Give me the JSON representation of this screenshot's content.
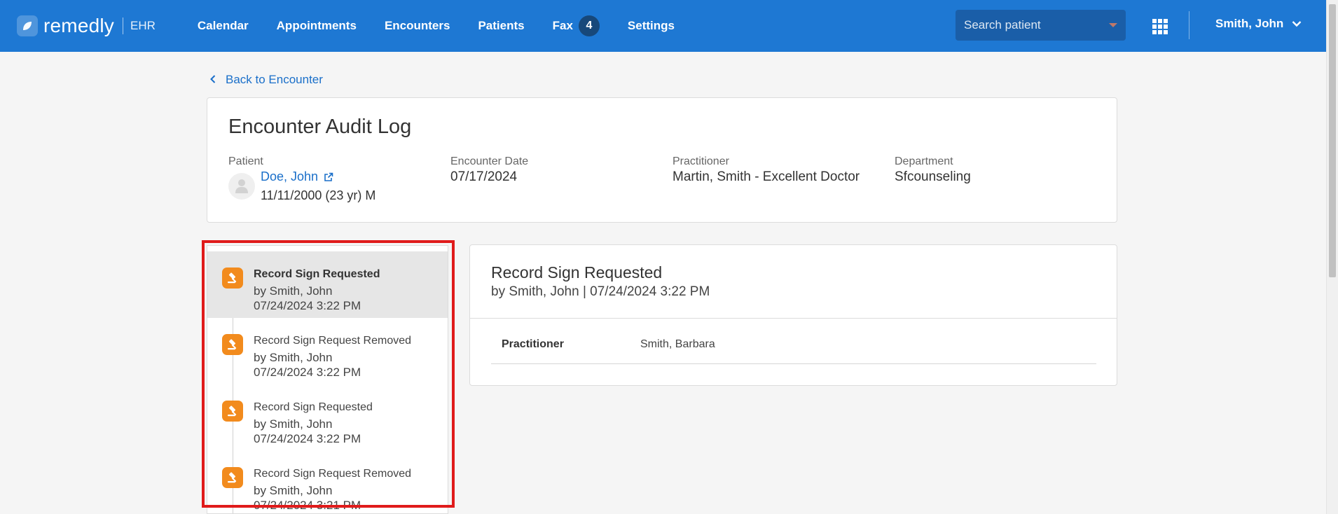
{
  "app": {
    "logo_text": "remedly",
    "logo_sub": "EHR"
  },
  "nav": {
    "items": [
      "Calendar",
      "Appointments",
      "Encounters",
      "Patients",
      "Fax",
      "Settings"
    ],
    "fax_count": "4"
  },
  "search": {
    "placeholder": "Search patient"
  },
  "user": {
    "name": "Smith, John"
  },
  "back_link": "Back to Encounter",
  "header": {
    "title": "Encounter Audit Log",
    "patient_label": "Patient",
    "patient_name": "Doe, John",
    "patient_dob": "11/11/2000 (23 yr) M",
    "date_label": "Encounter Date",
    "date_value": "07/17/2024",
    "practitioner_label": "Practitioner",
    "practitioner_value": "Martin, Smith - Excellent Doctor",
    "department_label": "Department",
    "department_value": "Sfcounseling"
  },
  "timeline": [
    {
      "title": "Record Sign Requested",
      "by": "by Smith, John",
      "date": "07/24/2024 3:22 PM"
    },
    {
      "title": "Record Sign Request Removed",
      "by": "by Smith, John",
      "date": "07/24/2024 3:22 PM"
    },
    {
      "title": "Record Sign Requested",
      "by": "by Smith, John",
      "date": "07/24/2024 3:22 PM"
    },
    {
      "title": "Record Sign Request Removed",
      "by": "by Smith, John",
      "date": "07/24/2024 3:21 PM"
    }
  ],
  "detail": {
    "title": "Record Sign Requested",
    "subtitle": "by Smith, John | 07/24/2024 3:22 PM",
    "row_label": "Practitioner",
    "row_value": "Smith, Barbara"
  },
  "colors": {
    "brand": "#1e78d3",
    "event_icon": "#f28b1d",
    "link": "#1a6fc9",
    "highlight": "#e01b1b"
  },
  "icons": {
    "event": "gavel-icon",
    "external": "external-link-icon",
    "apps": "grid-icon"
  }
}
